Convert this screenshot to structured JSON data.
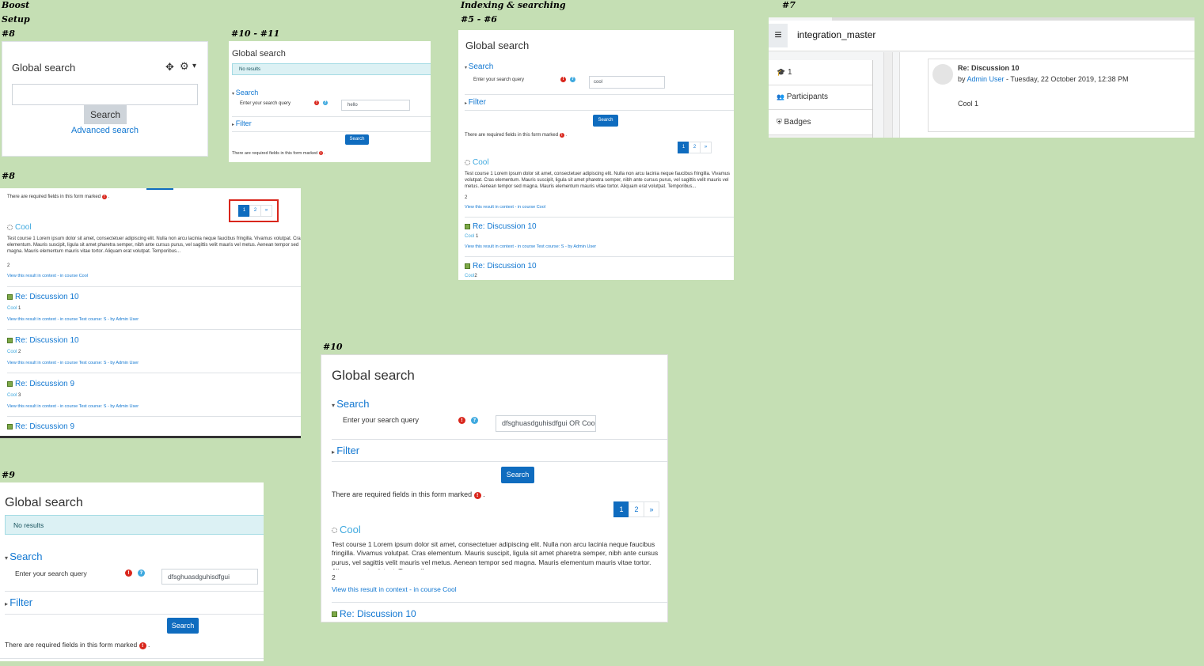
{
  "labels": {
    "boost": "Boost",
    "setup": "Setup",
    "p8a": "#8",
    "p1011": "#10 - #11",
    "indexing": "Indexing & searching",
    "p56": "#5 - #6",
    "p7": "#7",
    "p8b": "#8",
    "p10": "#10",
    "p9": "#9"
  },
  "common": {
    "global_search": "Global search",
    "search_section": "Search",
    "filter_section": "Filter",
    "query_label": "Enter your search query",
    "search_button": "Search",
    "required_note": "There are required fields in this form marked",
    "no_results": "No results",
    "view_context": "View this result in context",
    "in_course_cool": "in course Cool",
    "in_course_test": "in course Test course: S",
    "by_admin": "by Admin User",
    "cool": "Cool",
    "req_glyph": "!",
    "help_glyph": "?",
    "dash": " - ",
    "period": "."
  },
  "block8": {
    "title": "Global search",
    "move_icon": "✥",
    "gear_icon": "⚙",
    "caret_icon": "▾",
    "search_button": "Search",
    "advanced_link": "Advanced search"
  },
  "panel1011": {
    "query_value": "hello"
  },
  "panel56": {
    "query_value": "cool",
    "pages": [
      "1",
      "2",
      "»"
    ],
    "result1_title": "Cool",
    "snippet": "Test course 1 Lorem ipsum dolor sit amet, consectetuer adipiscing elit. Nulla non arcu lacinia neque faucibus fringilla. Vivamus volutpat. Cras elementum. Mauris suscipit, ligula sit amet pharetra semper, nibh ante cursus purus, vel sagittis velit mauris vel metus. Aenean tempor sed magna. Mauris elementum mauris vitae tortor. Aliquam erat volutpat. Temporibus...",
    "result1_num": "2",
    "result2_title": "Re: Discussion 10",
    "result2_num": "1",
    "result3_title": "Re: Discussion 10",
    "result3_num": "2"
  },
  "panel7": {
    "menu_icon": "≡",
    "site_name": "integration_master",
    "nav_items": [
      {
        "icon": "🎓",
        "label": "1"
      },
      {
        "icon": "👥",
        "label": "Participants"
      },
      {
        "icon": "⛨",
        "label": "Badges"
      }
    ],
    "post_title": "Re: Discussion 10",
    "by": "by",
    "author": "Admin User",
    "date": " - Tuesday, 22 October 2019, 12:38 PM",
    "body": "Cool 1"
  },
  "panel8": {
    "pages": [
      "1",
      "2",
      "»"
    ],
    "result1_title": "Cool",
    "snippet": "Test course 1 Lorem ipsum dolor sit amet, consectetuer adipiscing elit. Nulla non arcu lacinia neque faucibus fringilla. Vivamus volutpat. Cras elementum. Mauris suscipit, ligula sit amet pharetra semper, nibh ante cursus purus, vel sagittis velit mauris vel metus. Aenean tempor sed magna. Mauris elementum mauris vitae tortor. Aliquam erat volutpat. Temporibus...",
    "result1_num": "2",
    "results": [
      {
        "title": "Re: Discussion 10",
        "num": "1"
      },
      {
        "title": "Re: Discussion 10",
        "num": "2"
      },
      {
        "title": "Re: Discussion 9",
        "num": "3"
      }
    ],
    "last_title": "Re: Discussion 9"
  },
  "panel10": {
    "query_value": "dfsghuasdguhisdfgui OR Coo",
    "pages": [
      "1",
      "2",
      "»"
    ],
    "result1_title": "Cool",
    "snippet": "Test course 1 Lorem ipsum dolor sit amet, consectetuer adipiscing elit. Nulla non arcu lacinia neque faucibus fringilla. Vivamus volutpat. Cras elementum. Mauris suscipit, ligula sit amet pharetra semper, nibh ante cursus purus, vel sagittis velit mauris vel metus. Aenean tempor sed magna. Mauris elementum mauris vitae tortor. Aliquam erat volutpat. Temporibus...",
    "result1_num": "2",
    "result2_title": "Re: Discussion 10"
  },
  "panel9": {
    "query_value": "dfsghuasdguhisdfgui"
  }
}
